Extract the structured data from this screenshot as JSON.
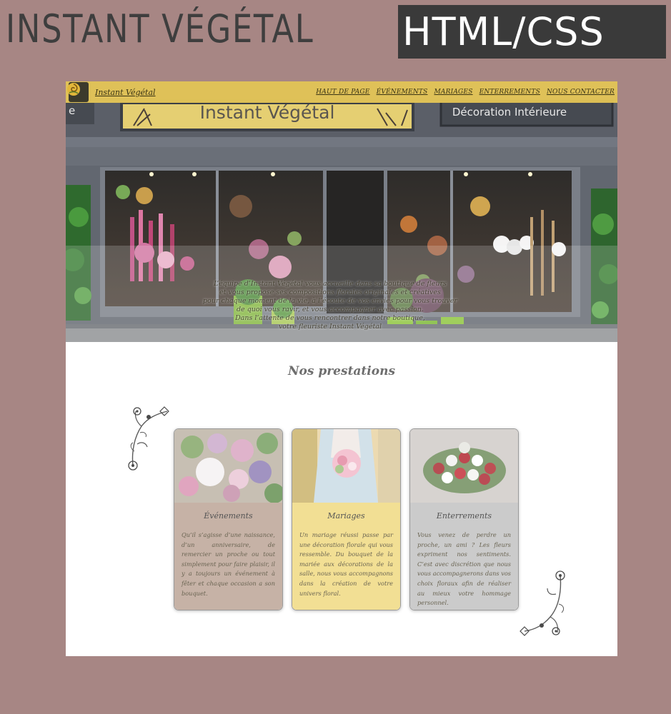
{
  "banner": {
    "title": "INSTANT VÉGÉTAL",
    "tag": "HTML/CSS"
  },
  "nav": {
    "brand": "Instant Végétal",
    "links": [
      "HAUT DE PAGE",
      "ÉVÉNEMENTS",
      "MARIAGES",
      "ENTERREMENTS",
      "NOUS CONTACTER"
    ]
  },
  "hero": {
    "sign_main": "Instant Végétal",
    "sign_side": "Décoration Intérieure",
    "sign_left": "e",
    "text_lines": [
      "L’équipe d’Instant Végétal vous accueille dans sa boutique de fleurs",
      "et vous propose ses compositions florales originales et créatives",
      "pour chaque moment de la vie, à l’écoute de vos envies pour vous trouver",
      "de quoi vous ravir, et vous accompagner avec passion.",
      "Dans l’attente de vous rencontrer dans notre boutique,",
      "votre fleuriste Instant Végétal"
    ]
  },
  "prestations": {
    "title": "Nos prestations",
    "cards": [
      {
        "title": "Événements",
        "text": "Qu’il s’agisse d’une naissance, d’un anniversaire, de remercier un proche ou tout simplement pour faire plaisir, il y a toujours un événement à fêter et chaque occasion a son bouquet."
      },
      {
        "title": "Mariages",
        "text": "Un mariage réussi passe par une décoration florale qui vous ressemble. Du bouquet de la mariée aux décorations de la salle, nous vous accompagnons dans la création de votre univers floral."
      },
      {
        "title": "Enterrements",
        "text": "Vous venez de perdre un proche, un ami ? Les fleurs expriment nos sentiments. C’est avec discrétion que nous vous accompagnerons dans vos choix floraux afin de réaliser au mieux votre hommage personnel."
      }
    ]
  },
  "colors": {
    "page_bg": "#a78684",
    "navbar": "#e8c856",
    "card_events": "#c6b2a6",
    "card_weddings": "#f2df94",
    "card_funerals": "#cbcbcb"
  },
  "icons": [
    "rose-logo-icon",
    "floral-corner-ornament-icon"
  ]
}
